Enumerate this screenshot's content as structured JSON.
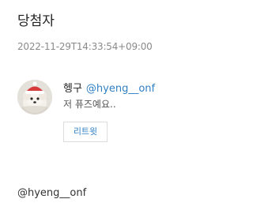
{
  "page": {
    "title": "당첨자",
    "timestamp": "2022-11-29T14:33:54+09:00"
  },
  "comment": {
    "avatar_icon": "profile-photo-avatar",
    "user_name": "헹구",
    "user_handle": "@hyeng__onf",
    "text": "저 퓨즈예요..",
    "retweet_label": "리트윗"
  },
  "footer": {
    "handle": "@hyeng__onf"
  },
  "colors": {
    "link_blue": "#2f7fc4",
    "muted_gray": "#8a8a8a",
    "border_gray": "#dcdcdc"
  }
}
